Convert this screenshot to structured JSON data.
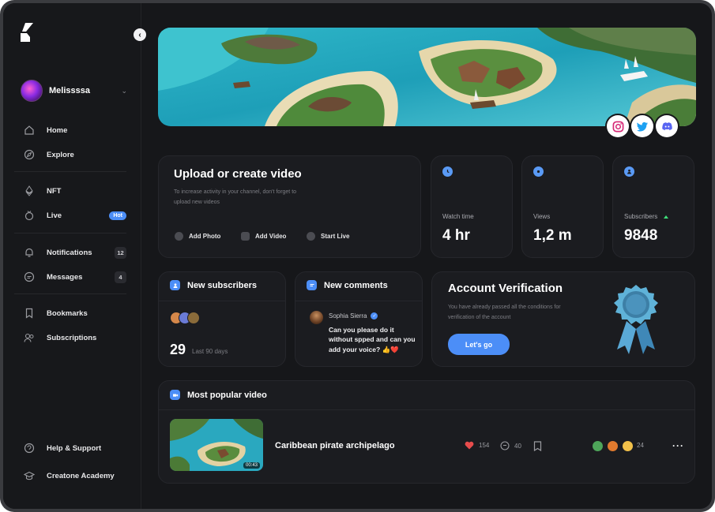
{
  "user": {
    "name": "Melissssa"
  },
  "nav": {
    "home": "Home",
    "explore": "Explore",
    "nft": "NFT",
    "live": "Live",
    "live_badge": "Hot",
    "notifications": "Notifications",
    "notifications_count": "12",
    "messages": "Messages",
    "messages_count": "4",
    "bookmarks": "Bookmarks",
    "subscriptions": "Subscriptions",
    "help": "Help & Support",
    "academy": "Creatone Academy"
  },
  "banner": {
    "socials": [
      "instagram-icon",
      "twitter-icon",
      "discord-icon"
    ]
  },
  "upload": {
    "title": "Upload or create video",
    "description": "To increase activity in your channel, don't forget to upload new videos",
    "add_photo": "Add Photo",
    "add_video": "Add Video",
    "start_live": "Start Live"
  },
  "stats": {
    "watch_time_label": "Watch time",
    "watch_time_value": "4 hr",
    "views_label": "Views",
    "views_value": "1,2 m",
    "subscribers_label": "Subscribers",
    "subscribers_value": "9848"
  },
  "new_subscribers": {
    "title": "New subscribers",
    "count": "29",
    "period": "Last 90 days"
  },
  "new_comments": {
    "title": "New comments",
    "author": "Sophia Sierra",
    "text": "Can you please do it without spped and can you add your voice? 👍❤️"
  },
  "verification": {
    "title": "Account Verification",
    "description": "You have already passed all the conditions for verification of the account",
    "button": "Let's go"
  },
  "popular": {
    "title": "Most popular video",
    "video_title": "Caribbean pirate archipelago",
    "duration": "00:43",
    "likes": "154",
    "comments": "40",
    "reactions": "24"
  },
  "colors": {
    "accent": "#4c8ef7",
    "background": "#16171a",
    "card": "#1b1c20",
    "positive": "#3ee07a"
  }
}
